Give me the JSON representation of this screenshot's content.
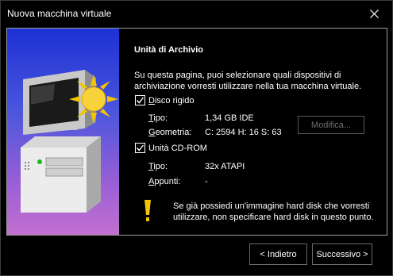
{
  "window": {
    "title": "Nuova macchina virtuale"
  },
  "page": {
    "heading": "Unità di Archivio",
    "intro": "Su questa pagina, puoi selezionare quali dispositivi di archiviazione vorresti utilizzare nella tua macchina virtuale."
  },
  "hard_disk": {
    "label": "Disco rigido",
    "checked": true,
    "type_label": "Tipo:",
    "type_value": "1,34 GB IDE",
    "geometry_label": "Geometria:",
    "geometry_value": "C: 2594 H: 16 S: 63",
    "modify_button": "Modifica..."
  },
  "cdrom": {
    "label": "Unità CD-ROM",
    "checked": true,
    "type_label": "Tipo:",
    "type_value": "32x ATAPI",
    "notes_label": "Appunti:",
    "notes_value": "-"
  },
  "warning": {
    "text": "Se già possiedi un'immagine hard disk che vorresti utilizzare, non specificare hard disk in questo punto."
  },
  "buttons": {
    "back": "< Indietro",
    "next": "Successivo >"
  },
  "colors": {
    "side_gradient_top": "#1d30d4",
    "side_gradient_bottom": "#c270d0",
    "warning_icon": "#f2c500"
  }
}
